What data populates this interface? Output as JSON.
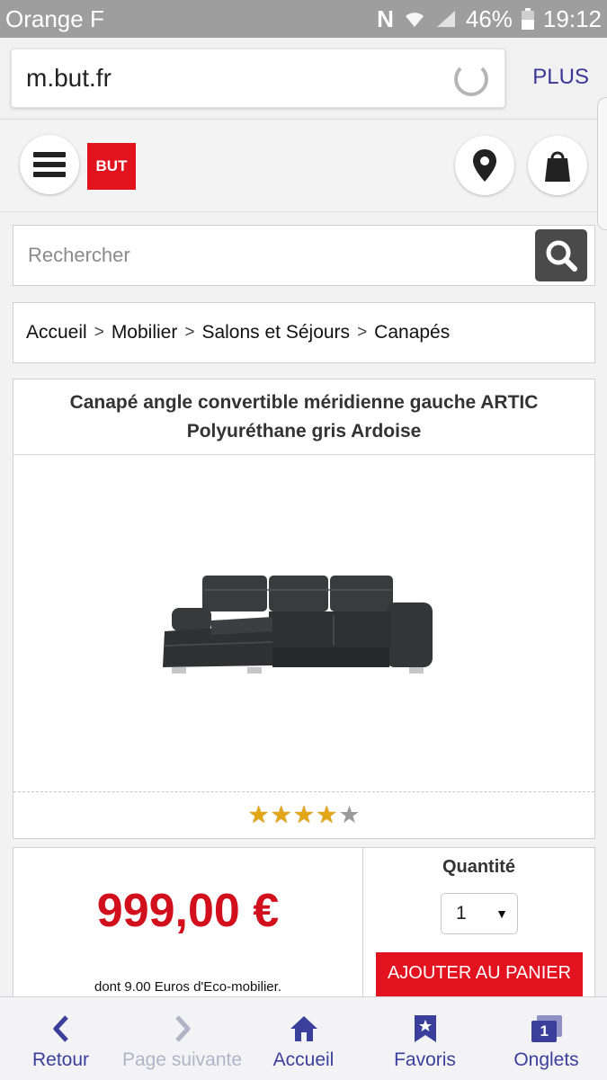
{
  "status_bar": {
    "carrier": "Orange F",
    "battery": "46%",
    "time": "19:12"
  },
  "browser": {
    "url": "m.but.fr",
    "menu_label": "PLUS"
  },
  "header": {
    "logo_text": "BUT"
  },
  "search": {
    "placeholder": "Rechercher"
  },
  "breadcrumb": [
    "Accueil",
    "Mobilier",
    "Salons et Séjours",
    "Canapés"
  ],
  "breadcrumb_separator": ">",
  "product": {
    "title": "Canapé angle convertible méridienne gauche ARTIC Polyuréthane gris Ardoise",
    "rating": 4,
    "rating_max": 5,
    "price": "999,00 €",
    "eco_note": "dont 9.00 Euros d'Eco-mobilier.",
    "quantity_label": "Quantité",
    "quantity_value": "1",
    "add_to_cart": "AJOUTER AU PANIER"
  },
  "bottom_nav": {
    "back": "Retour",
    "next": "Page suivante",
    "home": "Accueil",
    "favorites": "Favoris",
    "tabs": "Onglets",
    "tabs_count": "1"
  },
  "colors": {
    "brand_red": "#e2121f",
    "price_red": "#d20f1c",
    "nav_blue": "#3b3f9c"
  }
}
